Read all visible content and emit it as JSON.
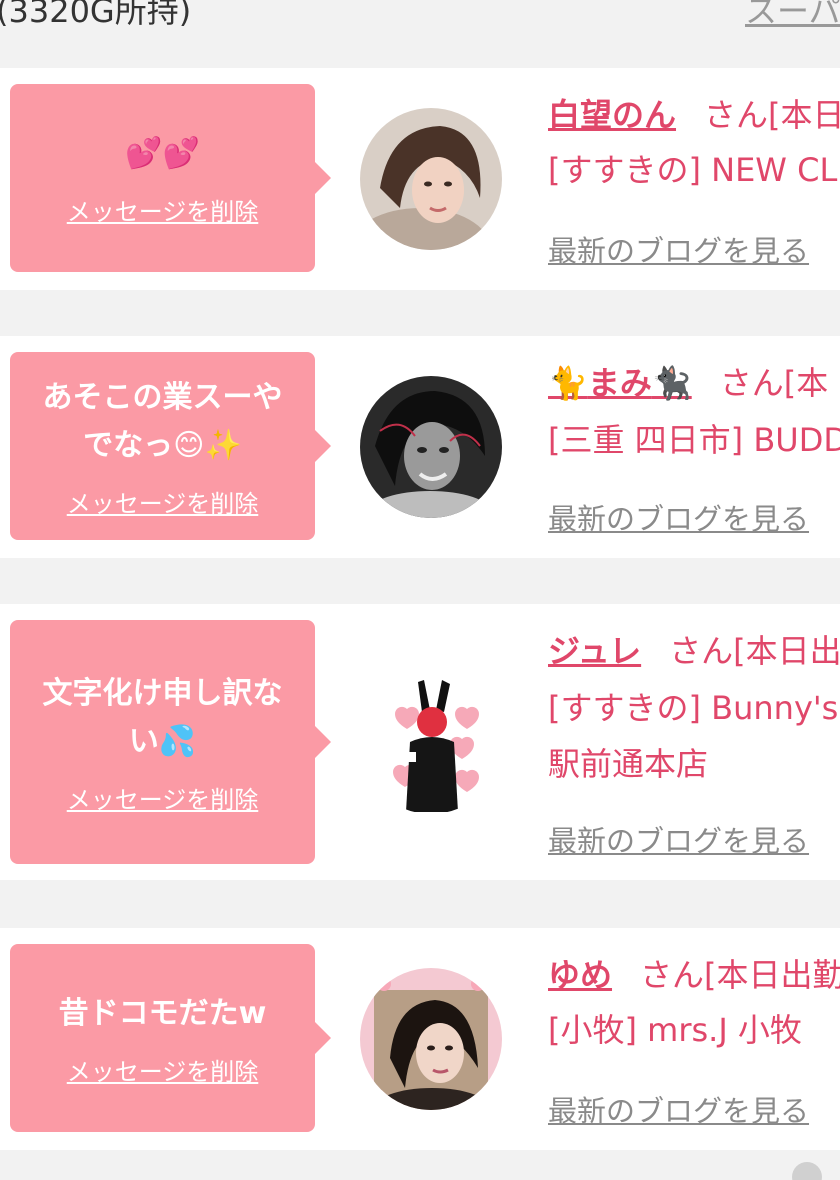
{
  "header": {
    "left_text": "(3320G所持)",
    "right_link": "スーパ"
  },
  "delete_label": "メッセージを削除",
  "blog_label": "最新のブログを見る",
  "cards": [
    {
      "message": "",
      "message_emoji": "💕💕",
      "name": "白望のん",
      "suffix": "さん[本日",
      "shop_lines": [
        "[すすきの] NEW CL"
      ]
    },
    {
      "message": "あそこの業スーやでなっ",
      "message_emoji": "😊✨",
      "name": "まみ",
      "name_prefix_emoji": "🐈",
      "name_suffix_emoji": "🐈‍⬛",
      "suffix": "さん[本",
      "shop_lines": [
        "[三重 四日市] BUDD"
      ]
    },
    {
      "message": "文字化け申し訳ない",
      "message_emoji": "💦",
      "name": "ジュレ",
      "suffix": "さん[本日出",
      "shop_lines": [
        "[すすきの] Bunny's",
        "駅前通本店"
      ]
    },
    {
      "message": "昔ドコモだたw",
      "message_emoji": "",
      "name": "ゆめ",
      "suffix": "さん[本日出勤",
      "shop_lines": [
        "[小牧] mrs.J 小牧"
      ]
    }
  ],
  "colors": {
    "bubble": "#fb9aa5",
    "accent": "#e0476a",
    "link_gray": "#8a8a8a",
    "background": "#f2f2f2"
  }
}
